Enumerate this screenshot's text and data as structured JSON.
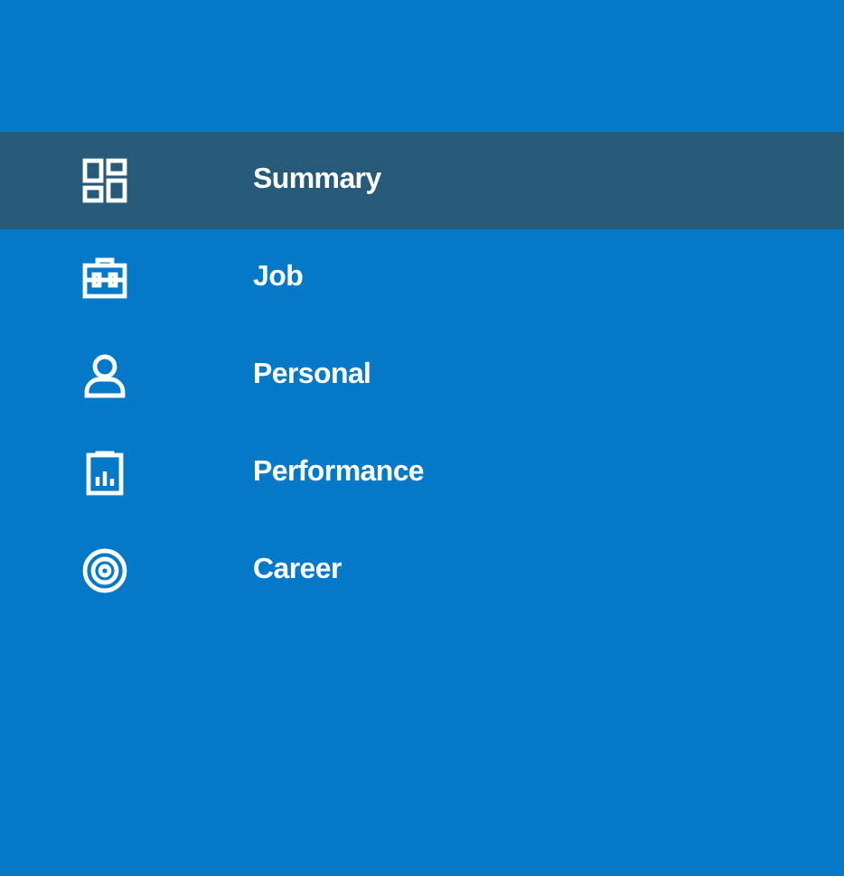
{
  "sidebar": {
    "items": [
      {
        "label": "Summary",
        "selected": true
      },
      {
        "label": "Job",
        "selected": false
      },
      {
        "label": "Personal",
        "selected": false
      },
      {
        "label": "Performance",
        "selected": false
      },
      {
        "label": "Career",
        "selected": false
      }
    ]
  }
}
